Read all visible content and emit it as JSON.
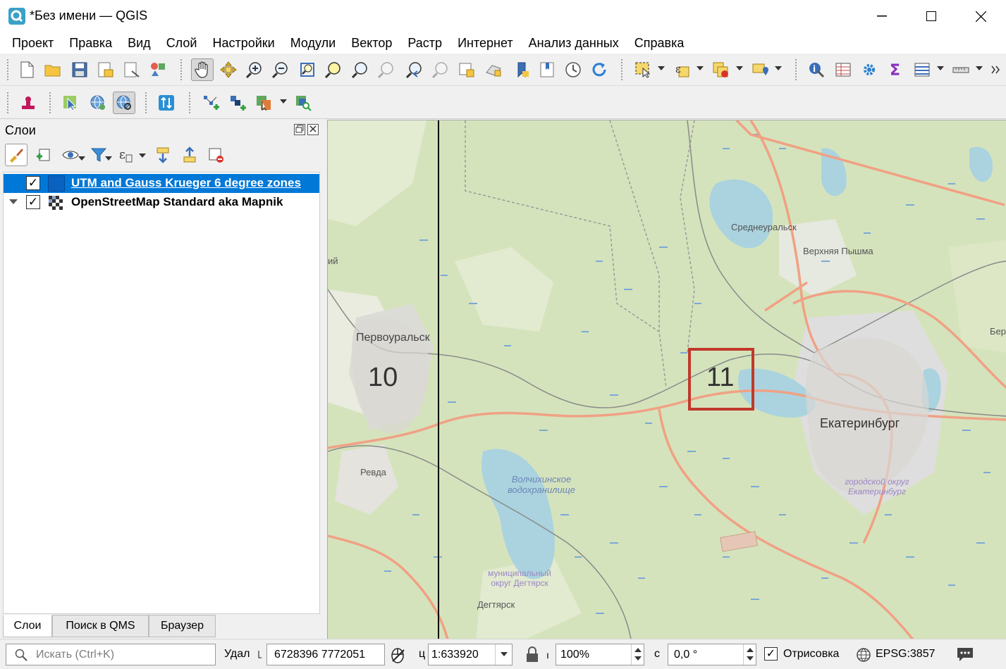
{
  "window": {
    "title": "*Без имени — QGIS",
    "minimize": "—",
    "maximize": "☐",
    "close": "✕"
  },
  "menu": [
    "Проект",
    "Правка",
    "Вид",
    "Слой",
    "Настройки",
    "Модули",
    "Вектор",
    "Растр",
    "Интернет",
    "Анализ данных",
    "Справка"
  ],
  "layers_panel": {
    "title": "Слои",
    "layers": [
      {
        "name": "UTM and Gauss Krueger 6 degree zones",
        "checked": true,
        "selected": true
      },
      {
        "name": "OpenStreetMap Standard aka Mapnik",
        "checked": true,
        "selected": false
      }
    ],
    "tabs": [
      "Слои",
      "Поиск в QMS",
      "Браузер"
    ]
  },
  "map": {
    "zone_labels": [
      "10",
      "11"
    ],
    "places": [
      "Среднеуральск",
      "Верхняя Пышма",
      "Первоуральск",
      "Екатеринбург",
      "Ревда",
      "Волчихинское водохранилище",
      "городской округ Екатеринбург",
      "муниципальный округ Дегтярск",
      "Дегтярск",
      "Берез",
      "ий"
    ]
  },
  "status": {
    "search_placeholder": "Искать (Ctrl+K)",
    "coord_label": "Удал",
    "coord_value": "6728396  7772051",
    "scale_label": "ц",
    "scale_value": "1:633920",
    "magnifier_value": "100%",
    "rotation_label": "с",
    "rotation_value": "0,0 °",
    "render_label": "Отрисовка",
    "render_checked": true,
    "crs": "EPSG:3857"
  },
  "colors": {
    "selection": "#0078d7",
    "map_green": "#cddfb0",
    "map_water": "#aad3df",
    "road": "#e8927c",
    "zone_highlight": "#c0392b"
  }
}
